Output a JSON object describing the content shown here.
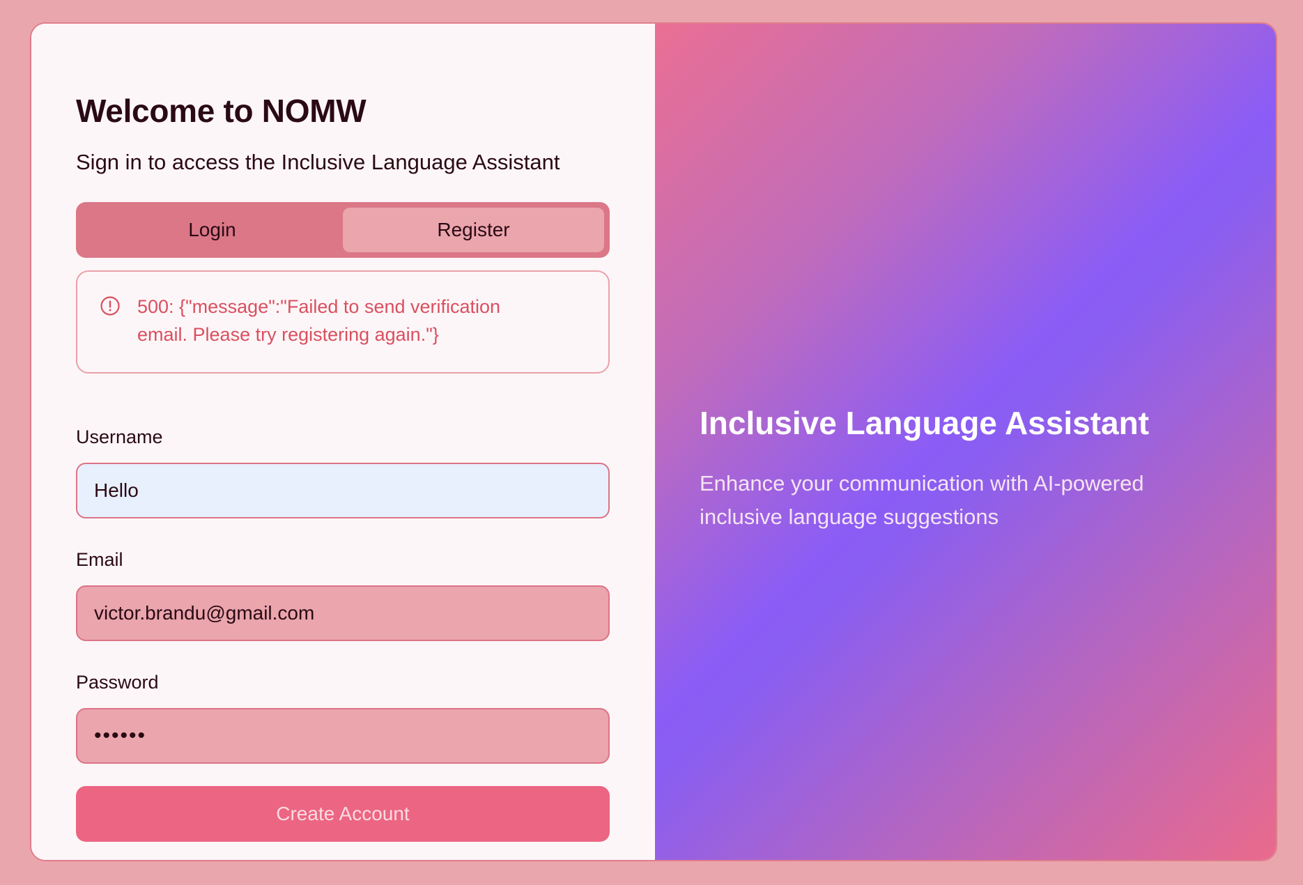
{
  "page": {
    "title": "Welcome to NOMW",
    "subtitle": "Sign in to access the Inclusive Language Assistant"
  },
  "tabs": [
    {
      "label": "Login",
      "active": false
    },
    {
      "label": "Register",
      "active": true
    }
  ],
  "alert": {
    "icon": "alert-circle-icon",
    "message": "500: {\"message\":\"Failed to send verification email. Please try registering again.\"}"
  },
  "form": {
    "username_label": "Username",
    "username_value": "Hello",
    "email_label": "Email",
    "email_value": "victor.brandu@gmail.com",
    "password_label": "Password",
    "password_masked": "••••••",
    "submit_label": "Create Account"
  },
  "hero": {
    "title": "Inclusive Language Assistant",
    "subtitle": "Enhance your communication with AI-powered inclusive language suggestions"
  },
  "colors": {
    "background": "#eaa6ad",
    "card": "#fdf6f8",
    "tab_track": "#db7787",
    "tab_active": "#eaa5ad",
    "error": "#d9505f",
    "primary_button": "#ec6582",
    "gradient_pink": "#ea6f93",
    "gradient_purple": "#8b5cf6"
  }
}
